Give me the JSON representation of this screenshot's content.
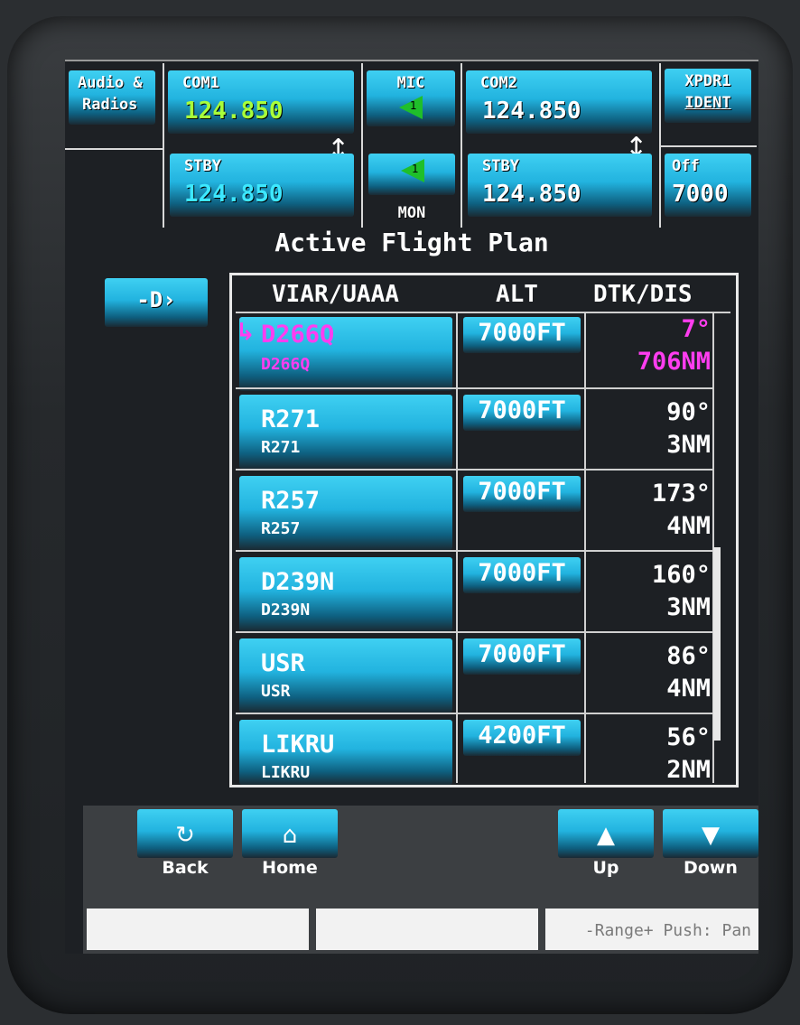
{
  "header": {
    "audio_label_1": "Audio &",
    "audio_label_2": "Radios",
    "com1_label": "COM1",
    "com1_active": "124.850",
    "com1_stby_label": "STBY",
    "com1_stby": "124.850",
    "mic_label": "MIC",
    "mic_num": "1",
    "mon_num": "1",
    "mon_label": "MON",
    "com2_label": "COM2",
    "com2_active": "124.850",
    "com2_stby_label": "STBY",
    "com2_stby": "124.850",
    "xpdr_label": "XPDR1",
    "ident_label": "IDENT",
    "xpdr_mode": "Off",
    "xpdr_code": "7000"
  },
  "page_title": "Active Flight Plan",
  "direct_to_label": "-D›",
  "table": {
    "col_wp": "VIAR/UAAA",
    "col_alt": "ALT",
    "col_dtk": "DTK/DIS",
    "rows": [
      {
        "name": "D266Q",
        "sub": "D266Q",
        "alt": "7000FT",
        "dtk": "7°",
        "dis": "706NM",
        "active": true
      },
      {
        "name": "R271",
        "sub": "R271",
        "alt": "7000FT",
        "dtk": "90°",
        "dis": "3NM"
      },
      {
        "name": "R257",
        "sub": "R257",
        "alt": "7000FT",
        "dtk": "173°",
        "dis": "4NM"
      },
      {
        "name": "D239N",
        "sub": "D239N",
        "alt": "7000FT",
        "dtk": "160°",
        "dis": "3NM"
      },
      {
        "name": "USR",
        "sub": "USR",
        "alt": "7000FT",
        "dtk": "86°",
        "dis": "4NM"
      },
      {
        "name": "LIKRU",
        "sub": "LIKRU",
        "alt": "4200FT",
        "dtk": "56°",
        "dis": "2NM"
      }
    ]
  },
  "nav": {
    "back": "Back",
    "home": "Home",
    "up": "Up",
    "down": "Down"
  },
  "softkeys": {
    "right_hint": "-Range+ Push: Pan"
  },
  "colors": {
    "accent": "#22b3df",
    "active_waypoint": "#ff3df0",
    "com1_active": "#a8ff3a",
    "com1_standby": "#3de8ff"
  },
  "icons": [
    "swap-arrow-icon",
    "mic-triangle-icon",
    "direct-to-icon",
    "back-icon",
    "home-icon",
    "up-arrow-icon",
    "down-arrow-icon",
    "active-leg-arrow-icon"
  ]
}
